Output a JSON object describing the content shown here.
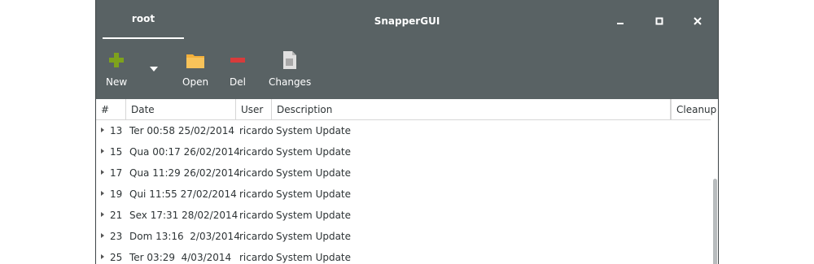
{
  "window": {
    "title": "SnapperGUI",
    "tab_label": "root",
    "controls": {
      "minimize": "–",
      "maximize": "□",
      "close": "✕"
    }
  },
  "toolbar": {
    "new_label": "New",
    "open_label": "Open",
    "del_label": "Del",
    "changes_label": "Changes"
  },
  "table": {
    "columns": [
      "#",
      "Date",
      "User",
      "Description",
      "Cleanup"
    ],
    "rows": [
      {
        "num": "13",
        "date": "Ter 00:58 25/02/2014",
        "user": "ricardo",
        "description": "System Update",
        "cleanup": ""
      },
      {
        "num": "15",
        "date": "Qua 00:17 26/02/2014",
        "user": "ricardo",
        "description": "System Update",
        "cleanup": ""
      },
      {
        "num": "17",
        "date": "Qua 11:29 26/02/2014",
        "user": "ricardo",
        "description": "System Update",
        "cleanup": ""
      },
      {
        "num": "19",
        "date": "Qui 11:55 27/02/2014",
        "user": "ricardo",
        "description": "System Update",
        "cleanup": ""
      },
      {
        "num": "21",
        "date": "Sex 17:31 28/02/2014",
        "user": "ricardo",
        "description": "System Update",
        "cleanup": ""
      },
      {
        "num": "23",
        "date": "Dom 13:16  2/03/2014",
        "user": "ricardo",
        "description": "System Update",
        "cleanup": ""
      },
      {
        "num": "25",
        "date": "Ter 03:29  4/03/2014",
        "user": "ricardo",
        "description": "System Update",
        "cleanup": ""
      }
    ]
  },
  "colors": {
    "header_bg": "#596264",
    "new_icon": "#7ea21c",
    "open_icon": "#f4b03a",
    "del_icon": "#d83b3b"
  }
}
